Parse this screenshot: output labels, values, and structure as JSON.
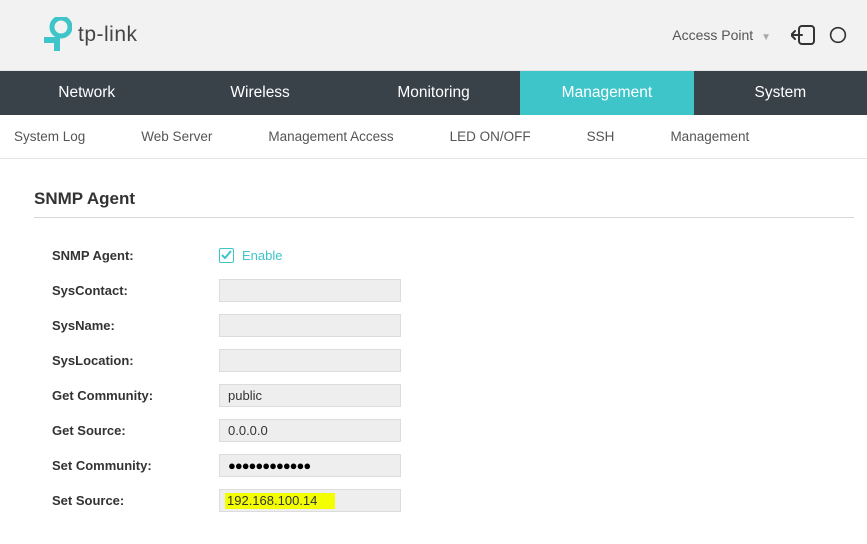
{
  "brand": {
    "name": "tp-link"
  },
  "top": {
    "mode": "Access Point"
  },
  "nav": {
    "items": [
      "Network",
      "Wireless",
      "Monitoring",
      "Management",
      "System"
    ],
    "activeIndex": 3
  },
  "subnav": {
    "items": [
      "System Log",
      "Web Server",
      "Management Access",
      "LED ON/OFF",
      "SSH",
      "Management"
    ]
  },
  "section": {
    "title": "SNMP Agent"
  },
  "form": {
    "snmp_agent_label": "SNMP Agent:",
    "enable_label": "Enable",
    "enable_checked": true,
    "syscontact_label": "SysContact:",
    "syscontact_value": "",
    "sysname_label": "SysName:",
    "sysname_value": "",
    "syslocation_label": "SysLocation:",
    "syslocation_value": "",
    "get_community_label": "Get Community:",
    "get_community_value": "public",
    "get_source_label": "Get Source:",
    "get_source_value": "0.0.0.0",
    "set_community_label": "Set Community:",
    "set_community_value": "●●●●●●●●●●●●",
    "set_source_label": "Set Source:",
    "set_source_value": "192.168.100.14"
  }
}
